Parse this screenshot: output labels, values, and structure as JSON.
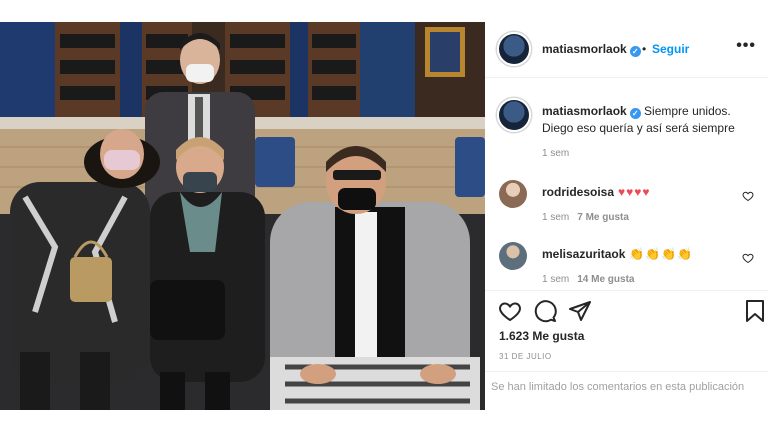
{
  "post": {
    "author": {
      "username": "matiasmorlaok",
      "verified_icon": "verified-badge-icon",
      "separator": "•",
      "follow_label": "Seguir",
      "more_icon": "more-options-icon",
      "more_glyph": "•••"
    },
    "photo": {
      "icon": "group-photo"
    },
    "caption": {
      "username": "matiasmorlaok",
      "text": "Siempre unidos. Diego eso quería y así será siempre",
      "time": "1 sem"
    },
    "comments": [
      {
        "username": "rodridesoisa",
        "text": "♥♥♥♥",
        "time": "1 sem",
        "likes": "7 Me gusta",
        "emoji_color": "#ed4956"
      },
      {
        "username": "melisazuritaok",
        "text": "👏👏👏👏",
        "time": "1 sem",
        "likes": "14 Me gusta",
        "emoji_color": "#e2a42a"
      }
    ],
    "actions": {
      "like_icon": "heart-icon",
      "comment_icon": "comment-icon",
      "share_icon": "share-icon",
      "save_icon": "bookmark-icon"
    },
    "likes_text": "1.623 Me gusta",
    "date": "31 DE JULIO",
    "comments_limited_text": "Se han limitado los comentarios en esta publicación"
  },
  "colors": {
    "accent": "#0095f6",
    "verified": "#3897f0",
    "secondary_text": "#8e8e8e",
    "divider": "#efefef"
  }
}
